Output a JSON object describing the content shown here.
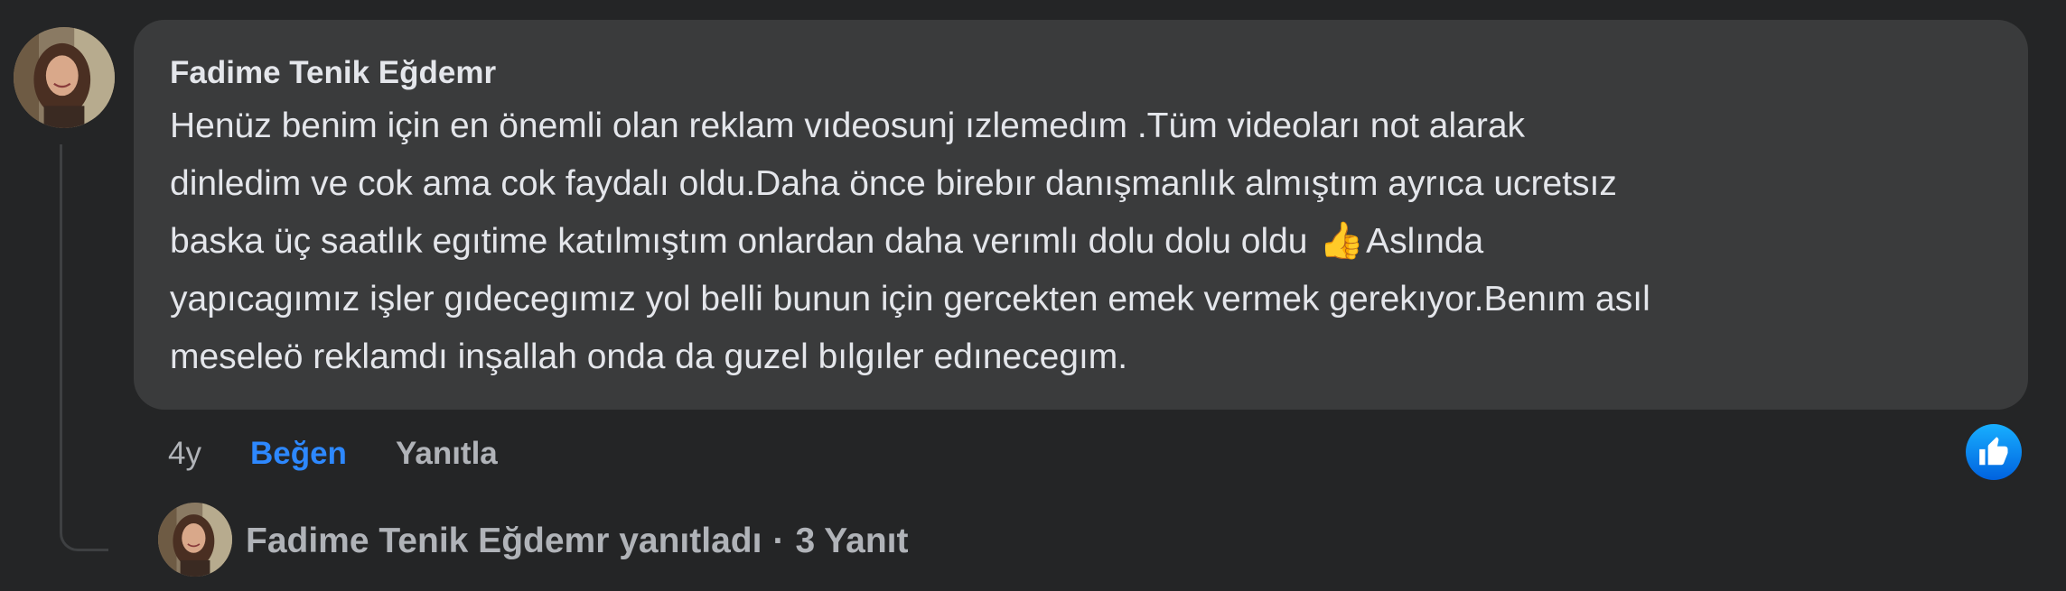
{
  "comment": {
    "author": "Fadime Tenik Eğdemr",
    "text_lines": [
      "Henüz benim için en önemli olan reklam vıdeosunj ızlemedım .Tüm videoları not alarak",
      "dinledim ve cok ama cok faydalı oldu.Daha önce birebır danışmanlık almıştım ayrıca ucretsız",
      "baska üç saatlık egıtime katılmıştım onlardan daha verımlı dolu dolu oldu",
      "Aslında",
      "yapıcagımız işler gıdecegımız yol belli bunun için gercekten emek vermek gerekıyor.Benım asıl",
      "meseleö reklamdı inşallah onda da guzel bılgıler edınecegım."
    ],
    "emoji": "👍"
  },
  "actions": {
    "time": "4y",
    "like": "Beğen",
    "reply": "Yanıtla"
  },
  "reaction": {
    "icon": "like-reaction-icon",
    "color": "#1877f2"
  },
  "replies": {
    "author": "Fadime Tenik Eğdemr",
    "verb": "yanıtladı",
    "separator": "·",
    "count": "3 Yanıt"
  },
  "colors": {
    "background": "#242526",
    "bubble": "#3a3b3c",
    "text": "#e4e6eb",
    "secondary": "#b0b3b8",
    "link": "#2d88ff"
  }
}
